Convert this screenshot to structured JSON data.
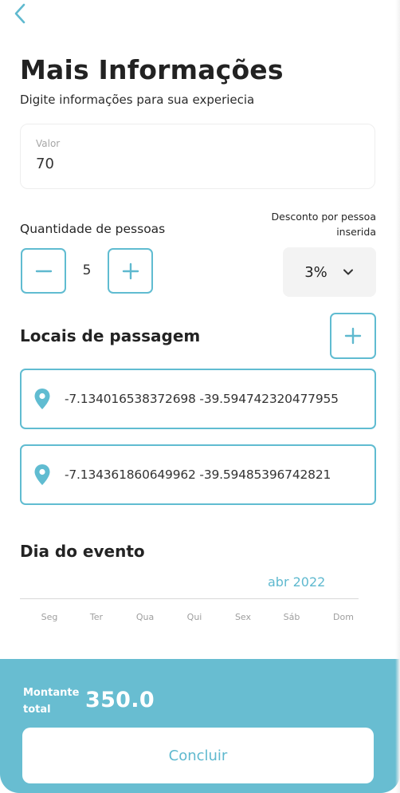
{
  "header": {
    "back_icon": "chevron-left-icon",
    "title": "Mais Informações",
    "subtitle": "Digite informações para sua experiecia"
  },
  "value_field": {
    "label": "Valor",
    "value": "70"
  },
  "quantity": {
    "label": "Quantidade de pessoas",
    "value": "5",
    "minus_icon": "minus-icon",
    "plus_icon": "plus-icon"
  },
  "discount": {
    "label_line1": "Desconto por pessoa",
    "label_line2": "inserida",
    "selected": "3%",
    "dropdown_icon": "chevron-down-icon"
  },
  "places": {
    "title": "Locais de passagem",
    "add_icon": "plus-icon",
    "items": [
      {
        "coords": "-7.134016538372698 -39.594742320477955",
        "icon": "map-pin-icon"
      },
      {
        "coords": "-7.134361860649962 -39.59485396742821",
        "icon": "map-pin-icon"
      }
    ]
  },
  "event_day": {
    "title": "Dia do evento",
    "month": "abr 2022",
    "weekdays": [
      "Seg",
      "Ter",
      "Qua",
      "Qui",
      "Sex",
      "Sáb",
      "Dom"
    ]
  },
  "footer": {
    "total_label_line1": "Montante",
    "total_label_line2": "total",
    "total_value": "350.0",
    "finish_label": "Concluir"
  },
  "colors": {
    "accent": "#60bcd1",
    "panel": "#68bdd1",
    "select_bg": "#f3f3f3"
  }
}
